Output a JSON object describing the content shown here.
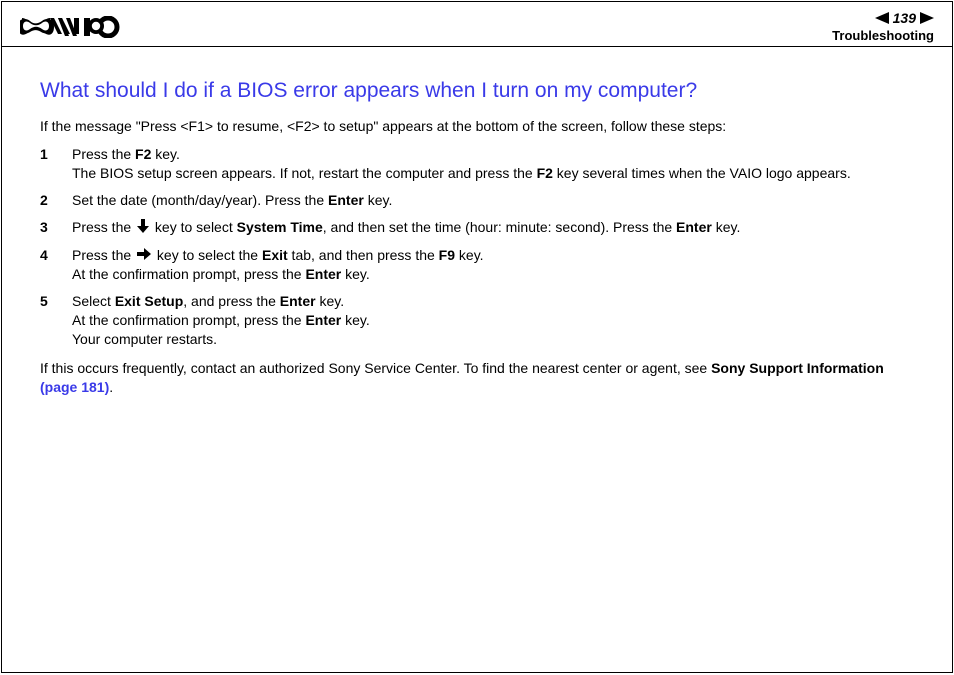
{
  "header": {
    "page_number": "139",
    "section": "Troubleshooting"
  },
  "title": "What should I do if a BIOS error appears when I turn on my computer?",
  "intro": "If the message \"Press <F1> to resume, <F2> to setup\" appears at the bottom of the screen, follow these steps:",
  "steps": [
    {
      "num": "1",
      "parts": [
        {
          "t": "Press the "
        },
        {
          "t": "F2",
          "b": true
        },
        {
          "t": " key."
        },
        {
          "br": true
        },
        {
          "t": "The BIOS setup screen appears. If not, restart the computer and press the "
        },
        {
          "t": "F2",
          "b": true
        },
        {
          "t": " key several times when the VAIO logo appears."
        }
      ]
    },
    {
      "num": "2",
      "parts": [
        {
          "t": "Set the date (month/day/year). Press the "
        },
        {
          "t": "Enter",
          "b": true
        },
        {
          "t": " key."
        }
      ]
    },
    {
      "num": "3",
      "parts": [
        {
          "t": "Press the "
        },
        {
          "icon": "down"
        },
        {
          "t": " key to select "
        },
        {
          "t": "System Time",
          "b": true
        },
        {
          "t": ", and then set the time (hour: minute: second). Press the "
        },
        {
          "t": "Enter",
          "b": true
        },
        {
          "t": " key."
        }
      ]
    },
    {
      "num": "4",
      "parts": [
        {
          "t": "Press the "
        },
        {
          "icon": "right"
        },
        {
          "t": " key to select the "
        },
        {
          "t": "Exit",
          "b": true
        },
        {
          "t": " tab, and then press the "
        },
        {
          "t": "F9",
          "b": true
        },
        {
          "t": " key."
        },
        {
          "br": true
        },
        {
          "t": "At the confirmation prompt, press the "
        },
        {
          "t": "Enter",
          "b": true
        },
        {
          "t": " key."
        }
      ]
    },
    {
      "num": "5",
      "parts": [
        {
          "t": "Select "
        },
        {
          "t": "Exit Setup",
          "b": true
        },
        {
          "t": ", and press the "
        },
        {
          "t": "Enter",
          "b": true
        },
        {
          "t": " key."
        },
        {
          "br": true
        },
        {
          "t": "At the confirmation prompt, press the "
        },
        {
          "t": "Enter",
          "b": true
        },
        {
          "t": " key."
        },
        {
          "br": true
        },
        {
          "t": "Your computer restarts."
        }
      ]
    }
  ],
  "footer_note": {
    "prefix": "If this occurs frequently, contact an authorized Sony Service Center. To find the nearest center or agent, see ",
    "bold": "Sony Support Information ",
    "link": "(page 181)",
    "suffix": "."
  }
}
